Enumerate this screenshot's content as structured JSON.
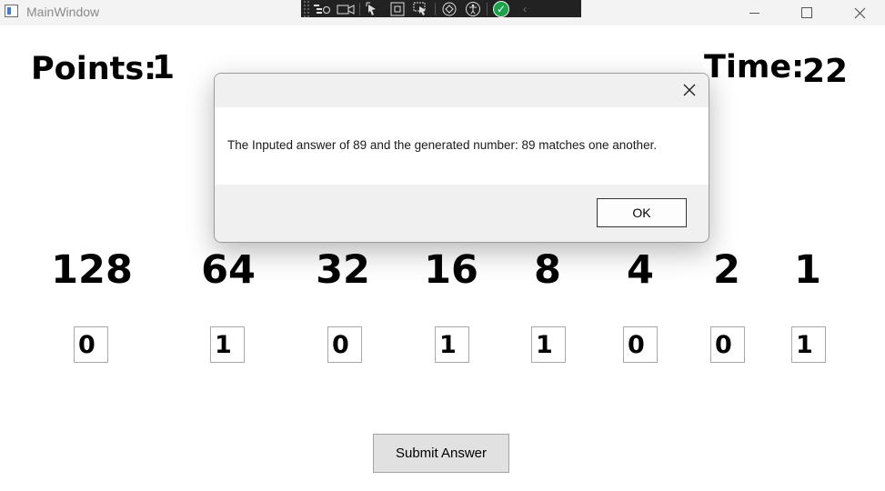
{
  "window": {
    "title": "MainWindow"
  },
  "debug_toolbar": {
    "icons": [
      "live-visual-tree-icon",
      "record-icon",
      "select-element-icon",
      "display-layout-adorners-icon",
      "track-focus-icon",
      "hot-reload-icon",
      "accessibility-icon",
      "binding-check-icon",
      "collapse-arrow-icon"
    ]
  },
  "game": {
    "points_label": "Points:",
    "points_value": "1",
    "time_label": "Time:",
    "time_value": "22",
    "bit_values": [
      "128",
      "64",
      "32",
      "16",
      "8",
      "4",
      "2",
      "1"
    ],
    "bit_inputs": [
      "0",
      "1",
      "0",
      "1",
      "1",
      "0",
      "0",
      "1"
    ],
    "submit_label": "Submit Answer"
  },
  "dialog": {
    "message": "The Inputed answer of 89 and the generated number: 89 matches one another.",
    "ok_label": "OK",
    "close_glyph": "✕"
  }
}
